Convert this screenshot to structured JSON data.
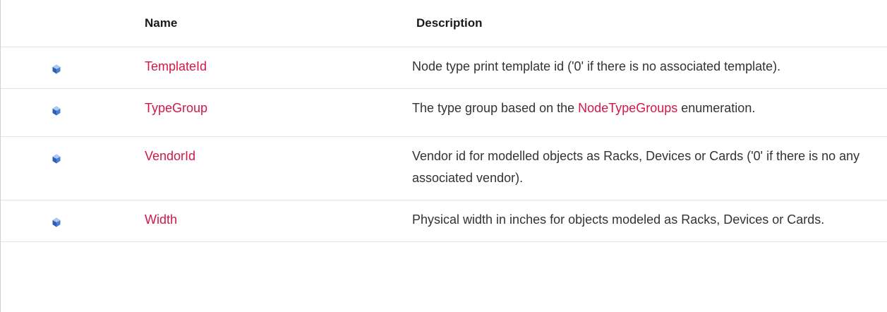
{
  "headers": {
    "name": "Name",
    "description": "Description"
  },
  "rows": [
    {
      "icon": "public-property-icon",
      "name": "TemplateId",
      "description": "Node type print template id ('0' if there is no associated template)."
    },
    {
      "icon": "public-property-icon",
      "name": "TypeGroup",
      "description_before": "The type group based on the ",
      "description_link": "NodeTypeGroups",
      "description_after": " enumeration."
    },
    {
      "icon": "public-property-icon",
      "name": "VendorId",
      "description": "Vendor id for modelled objects as Racks, Devices or Cards ('0' if there is no any associated vendor)."
    },
    {
      "icon": "public-property-icon",
      "name": "Width",
      "description": "Physical width in inches for objects modeled as Racks, Devices or Cards."
    }
  ]
}
